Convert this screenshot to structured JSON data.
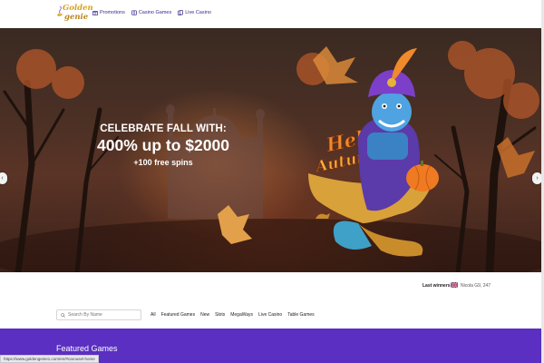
{
  "brand": {
    "line1": "Golden",
    "line2": "genie",
    "gold": "#d9a21b"
  },
  "nav": {
    "items": [
      {
        "label": "Promotions",
        "icon": "gift-icon"
      },
      {
        "label": "Casino Games",
        "icon": "slot-icon"
      },
      {
        "label": "Live Casino",
        "icon": "cards-icon"
      }
    ]
  },
  "hero": {
    "line1": "CELEBRATE FALL WITH:",
    "line2": "400% up to $2000",
    "line3": "+100 free spins",
    "badge1": "Hello",
    "badge2": "Autumn",
    "prev_icon": "chevron-left-icon",
    "next_icon": "chevron-right-icon",
    "prev_glyph": "‹",
    "next_glyph": "›"
  },
  "winners": {
    "label": "Last winners:",
    "entry": "Nicola G9, 247",
    "flag": "uk-flag-icon"
  },
  "search": {
    "placeholder": "Search By Name",
    "value": ""
  },
  "categories": [
    "All",
    "Featured Games",
    "New",
    "Slots",
    "MegaWays",
    "Live Casino",
    "Table Games"
  ],
  "featured": {
    "title": "Featured Games",
    "color": "#5a2fc1"
  },
  "status": {
    "url": "https://www.goldengenie1.com/en/#carousel-home"
  }
}
